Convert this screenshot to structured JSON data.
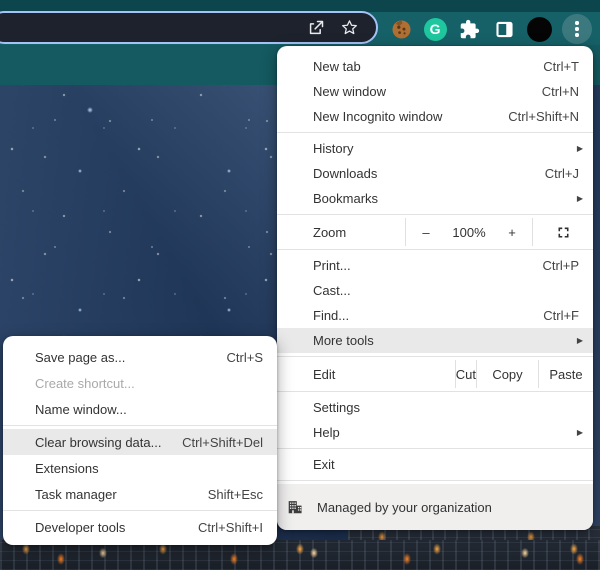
{
  "toolbar": {
    "omnibox_icons": [
      {
        "name": "share-icon"
      },
      {
        "name": "bookmark-star-icon"
      }
    ],
    "extension_icons": [
      {
        "name": "cookie-extension-icon"
      },
      {
        "name": "grammarly-extension-icon",
        "letter": "G"
      },
      {
        "name": "extensions-puzzle-icon"
      },
      {
        "name": "side-panel-icon"
      }
    ],
    "avatar": {
      "name": "profile-avatar"
    },
    "menu_button": {
      "name": "three-dot-menu-button"
    }
  },
  "colors": {
    "toolbar_teal": "#166067",
    "tab_strip_teal": "#0c464c",
    "focus_ring_blue": "#a4c2f5",
    "omnibox_bg": "#1d222c",
    "grammarly_green": "#1ec79e",
    "menu_highlight": "#e9e9e9",
    "managed_bg": "#f0efee"
  },
  "main_menu": {
    "items": [
      {
        "type": "item",
        "id": "new-tab",
        "label": "New tab",
        "shortcut": "Ctrl+T"
      },
      {
        "type": "item",
        "id": "new-window",
        "label": "New window",
        "shortcut": "Ctrl+N"
      },
      {
        "type": "item",
        "id": "new-incognito-window",
        "label": "New Incognito window",
        "shortcut": "Ctrl+Shift+N"
      },
      {
        "type": "divider"
      },
      {
        "type": "item",
        "id": "history",
        "label": "History",
        "submenu": true
      },
      {
        "type": "item",
        "id": "downloads",
        "label": "Downloads",
        "shortcut": "Ctrl+J"
      },
      {
        "type": "item",
        "id": "bookmarks",
        "label": "Bookmarks",
        "submenu": true
      },
      {
        "type": "divider"
      },
      {
        "type": "zoom",
        "id": "zoom",
        "label": "Zoom",
        "minus": "–",
        "level": "100%",
        "plus": "+"
      },
      {
        "type": "divider"
      },
      {
        "type": "item",
        "id": "print",
        "label": "Print...",
        "shortcut": "Ctrl+P"
      },
      {
        "type": "item",
        "id": "cast",
        "label": "Cast..."
      },
      {
        "type": "item",
        "id": "find",
        "label": "Find...",
        "shortcut": "Ctrl+F"
      },
      {
        "type": "item",
        "id": "more-tools",
        "label": "More tools",
        "submenu": true,
        "highlighted": true
      },
      {
        "type": "divider"
      },
      {
        "type": "edit",
        "id": "edit",
        "label": "Edit",
        "actions": [
          {
            "id": "cut",
            "label": "Cut"
          },
          {
            "id": "copy",
            "label": "Copy"
          },
          {
            "id": "paste",
            "label": "Paste"
          }
        ]
      },
      {
        "type": "divider"
      },
      {
        "type": "item",
        "id": "settings",
        "label": "Settings"
      },
      {
        "type": "item",
        "id": "help",
        "label": "Help",
        "submenu": true
      },
      {
        "type": "divider"
      },
      {
        "type": "item",
        "id": "exit",
        "label": "Exit"
      },
      {
        "type": "divider"
      },
      {
        "type": "managed",
        "id": "managed",
        "label": "Managed by your organization"
      }
    ]
  },
  "sub_menu": {
    "items": [
      {
        "type": "item",
        "id": "save-page-as",
        "label": "Save page as...",
        "shortcut": "Ctrl+S"
      },
      {
        "type": "item",
        "id": "create-shortcut",
        "label": "Create shortcut...",
        "disabled": true
      },
      {
        "type": "item",
        "id": "name-window",
        "label": "Name window..."
      },
      {
        "type": "divider"
      },
      {
        "type": "item",
        "id": "clear-browsing-data",
        "label": "Clear browsing data...",
        "shortcut": "Ctrl+Shift+Del",
        "highlighted": true
      },
      {
        "type": "item",
        "id": "extensions",
        "label": "Extensions"
      },
      {
        "type": "item",
        "id": "task-manager",
        "label": "Task manager",
        "shortcut": "Shift+Esc"
      },
      {
        "type": "divider"
      },
      {
        "type": "item",
        "id": "developer-tools",
        "label": "Developer tools",
        "shortcut": "Ctrl+Shift+I"
      }
    ]
  }
}
